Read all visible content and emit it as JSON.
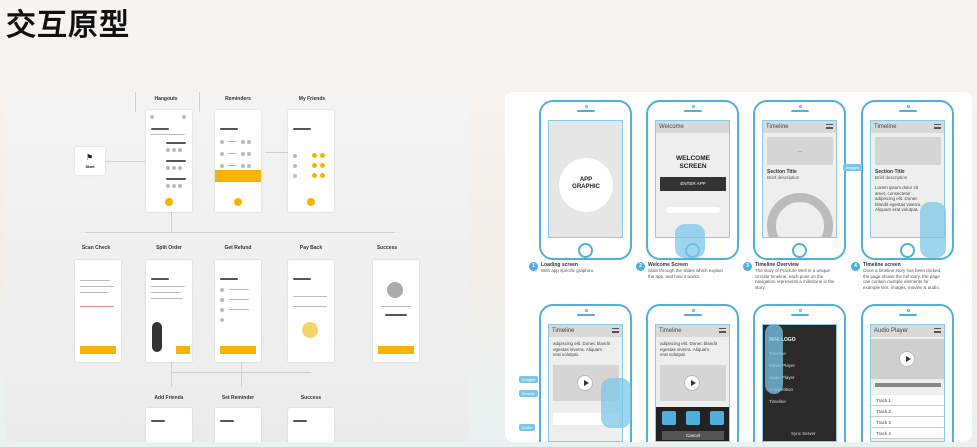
{
  "page": {
    "title": "交互原型"
  },
  "left_flow": {
    "start": {
      "label": "Start"
    },
    "top_row": [
      {
        "label": "Hangouts"
      },
      {
        "label": "Reminders"
      },
      {
        "label": "My Friends"
      }
    ],
    "middle_row": [
      {
        "label": "Scan Check"
      },
      {
        "label": "Split Order"
      },
      {
        "label": "Get Refund"
      },
      {
        "label": "Pay Back"
      },
      {
        "label": "Success"
      }
    ],
    "bottom_row": [
      {
        "label": "Add Friends"
      },
      {
        "label": "Set Reminder"
      },
      {
        "label": "Success"
      }
    ],
    "accent_color": "#f4b400"
  },
  "right_wireframes": {
    "accent_color": "#4fb0dc",
    "phones": [
      {
        "screen_title": "",
        "center_text": "APP GRAPHIC",
        "caption_num": "1",
        "caption_title": "Loading screen",
        "caption_desc": "With app specific graphics."
      },
      {
        "screen_title": "Welcome",
        "center_text": "WELCOME SCREEN",
        "button": "ENTER APP",
        "caption_num": "2",
        "caption_title": "Welcome Screen",
        "caption_desc": "Slide through the slides which explain the app, and how it works."
      },
      {
        "screen_title": "Timeline",
        "section_title": "Section Title",
        "section_desc": "Brief description",
        "caption_num": "3",
        "caption_title": "Timeline Overview",
        "caption_desc": "The story of Fracture Well in a unique circular timeline, each point on the navigation represents a milestone in the story."
      },
      {
        "screen_title": "Timeline",
        "section_title": "Section Title",
        "section_desc": "Brief description",
        "body": "Lorem ipsum dolor sit amet, consectetur adipiscing elit. Donec blandit egestas viverra. Aliquam erat volutpat.",
        "tag": "Images",
        "caption_num": "4",
        "caption_title": "Timeline screen",
        "caption_desc": "Once a timeline story has been clicked, the page shows the full story, the page can contain multiple elements for example text, images, movies & audio."
      }
    ],
    "bottom_phones": [
      {
        "screen_title": "Timeline",
        "body": "adipiscing elit. Donec blandit egestas viverra. Aliquam erat volutpat.",
        "tags": [
          "Images",
          "Movies",
          "Audio"
        ]
      },
      {
        "screen_title": "Timeline",
        "body": "adipiscing elit. Donec blandit egestas viverra. Aliquam erat volutpat.",
        "cancel": "Cancel"
      },
      {
        "logo": "MINI LOGO",
        "menu": [
          "Timeline",
          "Movie Player",
          "Audio Player",
          "Competition",
          "Timeline"
        ],
        "footer": "Sync Server"
      },
      {
        "screen_title": "Audio Player",
        "tracks": [
          "Track 1",
          "Track 2",
          "Track 3",
          "Track 4"
        ]
      }
    ]
  }
}
